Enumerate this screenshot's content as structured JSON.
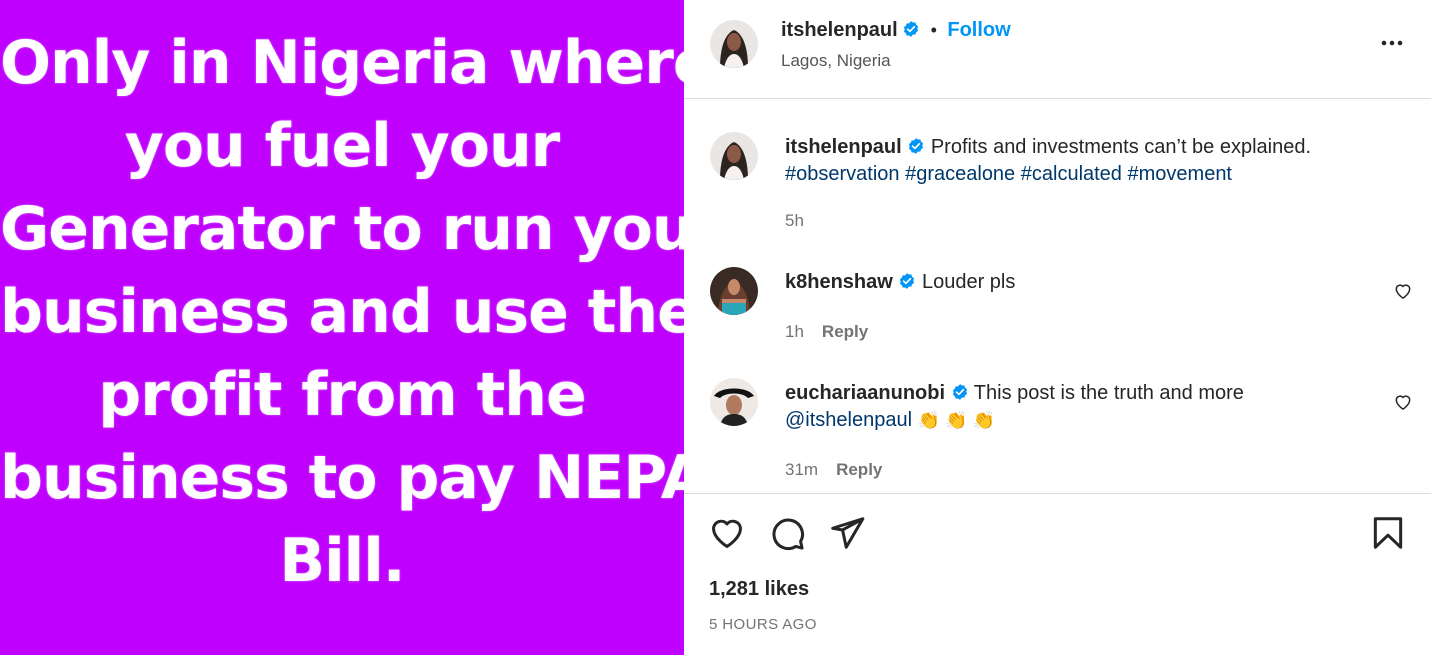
{
  "media": {
    "background": "#bf00ff",
    "lines": [
      "Only in Nigeria where",
      "you fuel your",
      "Generator to run your",
      "business and use the",
      "profit from the",
      "business to pay NEPA",
      "Bill."
    ]
  },
  "header": {
    "username": "itshelenpaul",
    "separator": "•",
    "follow_label": "Follow",
    "location": "Lagos, Nigeria",
    "more_icon": "more-horizontal-icon"
  },
  "caption": {
    "username": "itshelenpaul",
    "text": "Profits and investments can’t be explained.",
    "hashtags": [
      "#observation",
      "#gracealone",
      "#calculated",
      "#movement"
    ],
    "time": "5h"
  },
  "comments": [
    {
      "username": "k8henshaw",
      "text": "Louder pls",
      "time": "1h",
      "reply_label": "Reply"
    },
    {
      "username": "euchariaanunobi",
      "text": "This post is the truth and more",
      "mention": "@itshelenpaul",
      "emoji": "👏 👏 👏",
      "time": "31m",
      "reply_label": "Reply"
    }
  ],
  "actions": {
    "icons": [
      "heart-icon",
      "comment-icon",
      "share-icon",
      "bookmark-icon"
    ]
  },
  "likes": "1,281 likes",
  "posted": "5 HOURS AGO",
  "colors": {
    "accent": "#0095f6",
    "verified": "#0095f6",
    "link": "#00376b",
    "muted": "#737373"
  }
}
